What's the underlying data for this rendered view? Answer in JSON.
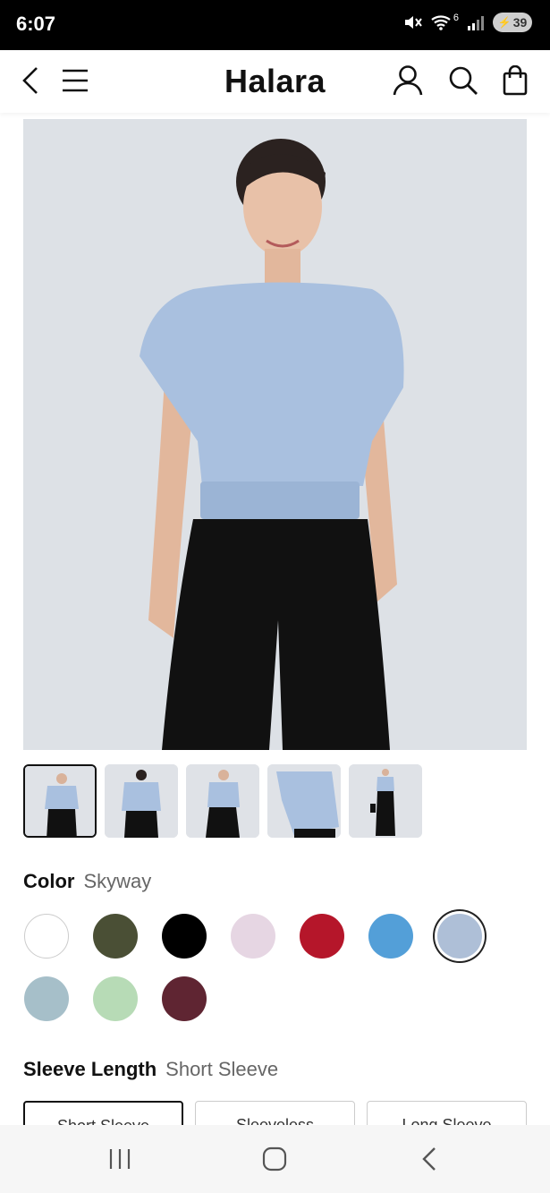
{
  "status_bar": {
    "time": "6:07",
    "battery": "39",
    "wifi_badge": "6"
  },
  "header": {
    "brand": "Halara"
  },
  "product": {
    "image_alt": "Model wearing light blue cropped short sleeve top with black wide-leg pants"
  },
  "color": {
    "label": "Color",
    "selected": "Skyway",
    "swatches": [
      {
        "name": "white",
        "hex": "#ffffff"
      },
      {
        "name": "olive",
        "hex": "#4a4f35"
      },
      {
        "name": "black",
        "hex": "#000000"
      },
      {
        "name": "lilac",
        "hex": "#e6d6e3"
      },
      {
        "name": "red",
        "hex": "#b5162a"
      },
      {
        "name": "blue",
        "hex": "#539fd8"
      },
      {
        "name": "skyway",
        "hex": "#aebfd7"
      },
      {
        "name": "sage-blue",
        "hex": "#a6bfc9"
      },
      {
        "name": "mint",
        "hex": "#b7dbb6"
      },
      {
        "name": "wine",
        "hex": "#5f2532"
      }
    ]
  },
  "sleeve": {
    "label": "Sleeve Length",
    "selected": "Short Sleeve",
    "options": [
      "Short Sleeve",
      "Sleeveless",
      "Long Sleeve"
    ]
  },
  "colors": {
    "accent": "#111111",
    "hero_bg": "#dde1e6",
    "top": "#a9c0df"
  }
}
